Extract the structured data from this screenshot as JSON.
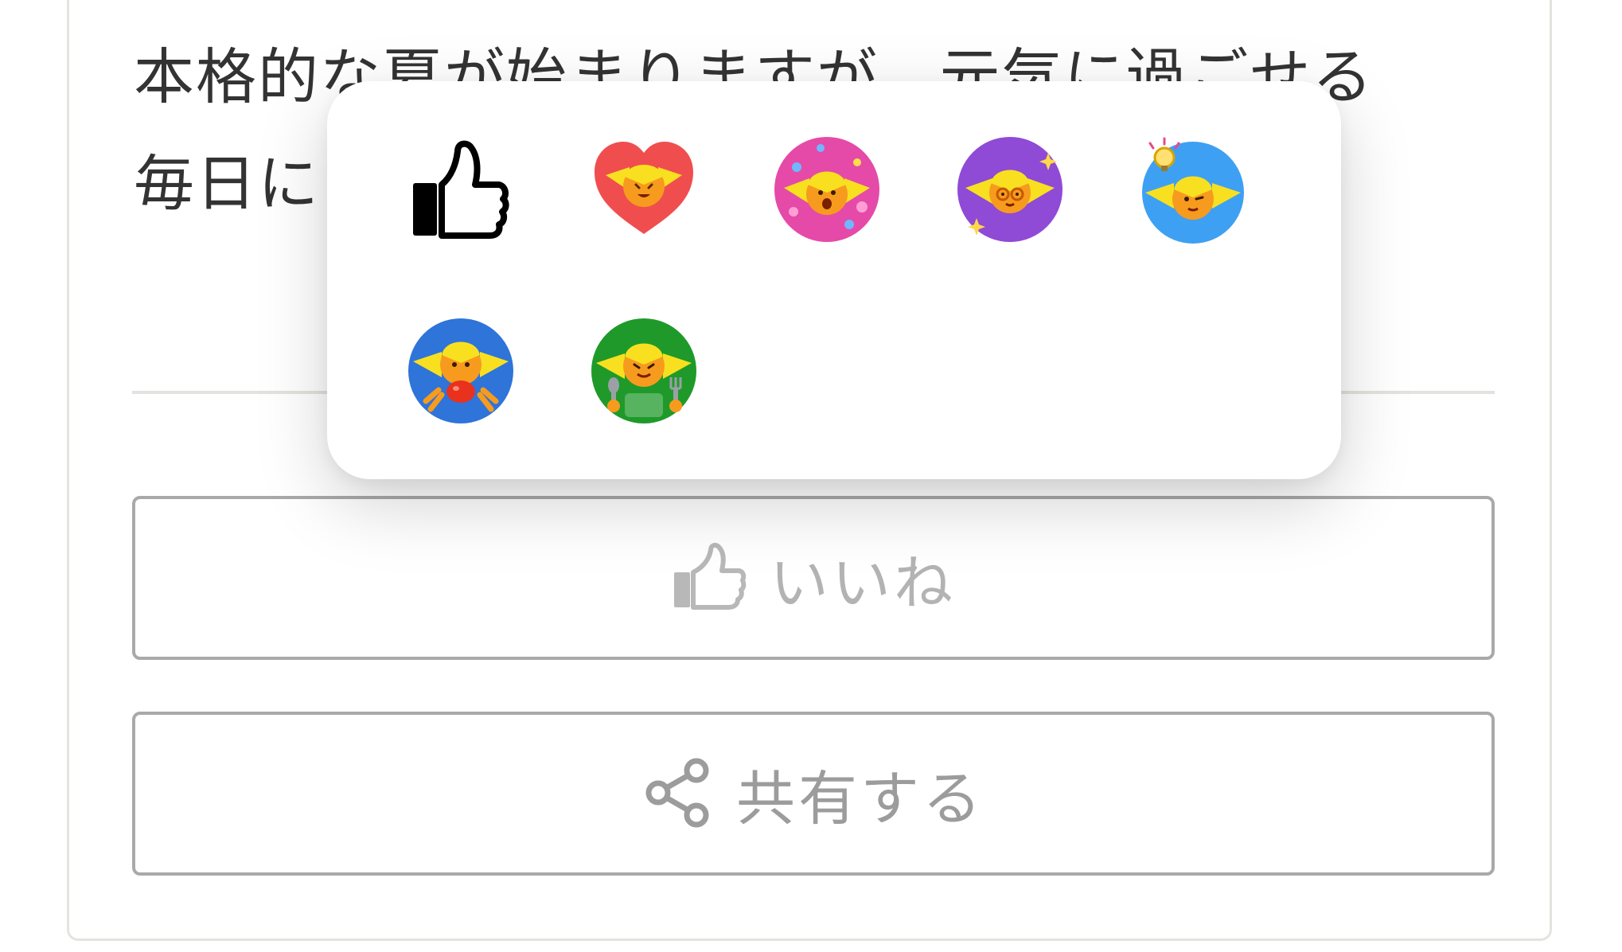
{
  "post": {
    "line1": "本格的な夏が始まりますが、元気に過ごせる",
    "line2": "毎日に"
  },
  "actions": {
    "like_label": "いいね",
    "share_label": "共有する"
  },
  "reactions": [
    {
      "name": "thumbs-up",
      "bg": "#000000"
    },
    {
      "name": "heart",
      "bg": "#f04e4e"
    },
    {
      "name": "celebrate",
      "bg": "#e54aa8"
    },
    {
      "name": "sparkle-glasses",
      "bg": "#8f4ad6"
    },
    {
      "name": "lightbulb",
      "bg": "#3ea0f2"
    },
    {
      "name": "food-crab",
      "bg": "#2e74d9"
    },
    {
      "name": "eating",
      "bg": "#1f9a2a"
    }
  ],
  "colors": {
    "text": "#333333",
    "button_border": "#a9a9a9",
    "button_text": "#b3b3b3",
    "divider": "#e2e2de"
  }
}
